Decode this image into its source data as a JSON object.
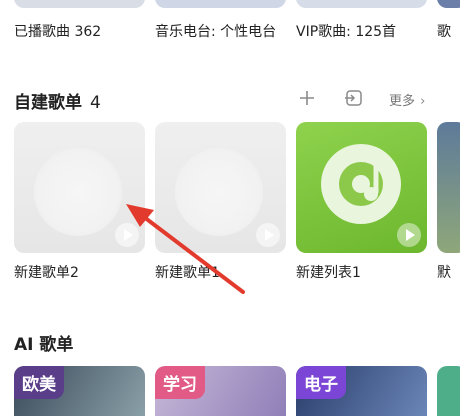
{
  "top_row": {
    "labels": [
      "已播歌曲 362",
      "音乐电台: 个性电台",
      "VIP歌曲: 125首",
      "歌"
    ]
  },
  "section_custom": {
    "title": "自建歌单",
    "count": "4",
    "more_label": "更多",
    "icons": [
      "plus-icon",
      "import-icon",
      "chevron-right-icon"
    ],
    "playlists": [
      {
        "label": "新建歌单2"
      },
      {
        "label": "新建歌单1"
      },
      {
        "label": "新建列表1"
      },
      {
        "label": "默"
      }
    ]
  },
  "section_ai": {
    "title": "AI 歌单",
    "cards": [
      {
        "tag": "欧美",
        "color": "#5a3e8a"
      },
      {
        "tag": "学习",
        "color": "#e25a86"
      },
      {
        "tag": "电子",
        "color": "#7b45d6"
      },
      {
        "tag": "",
        "color": "#4fae8a"
      }
    ]
  },
  "colors": {
    "accent_green": "#7cc23a",
    "arrow_red": "#e23b2e"
  }
}
